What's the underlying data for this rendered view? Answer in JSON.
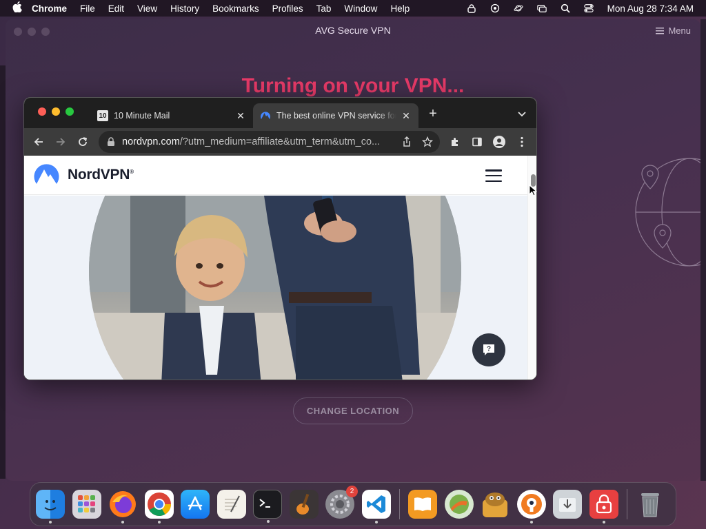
{
  "menubar": {
    "app": "Chrome",
    "items": [
      "File",
      "Edit",
      "View",
      "History",
      "Bookmarks",
      "Profiles",
      "Tab",
      "Window",
      "Help"
    ],
    "clock": "Mon Aug 28  7:34 AM"
  },
  "avg": {
    "title": "AVG Secure VPN",
    "menu_label": "Menu",
    "heading": "Turning on your VPN...",
    "change_location": "CHANGE LOCATION"
  },
  "chrome": {
    "tabs": [
      {
        "favicon_text": "10",
        "title": "10 Minute Mail"
      },
      {
        "title": "The best online VPN service for speed and security"
      }
    ],
    "omnibox": {
      "host": "nordvpn.com",
      "path": "/?utm_medium=affiliate&utm_term&utm_co..."
    },
    "page": {
      "brand": "NordVPN",
      "trademark": "®"
    }
  },
  "dock": {
    "settings_badge": "2",
    "apps": [
      "finder-icon",
      "launchpad-icon",
      "firefox-icon",
      "chrome-icon",
      "app-store-icon",
      "textedit-icon",
      "terminal-icon",
      "garageband-icon",
      "system-settings-icon",
      "vscode-icon",
      "books-icon",
      "vpn-app-icon",
      "cheese-app-icon",
      "openvpn-icon",
      "downloads-icon",
      "avg-vpn-icon",
      "trash-icon"
    ]
  },
  "colors": {
    "avg_heading": "#e83a68",
    "nord_blue": "#4687ff",
    "chrome_dark": "#1f1f1f"
  }
}
